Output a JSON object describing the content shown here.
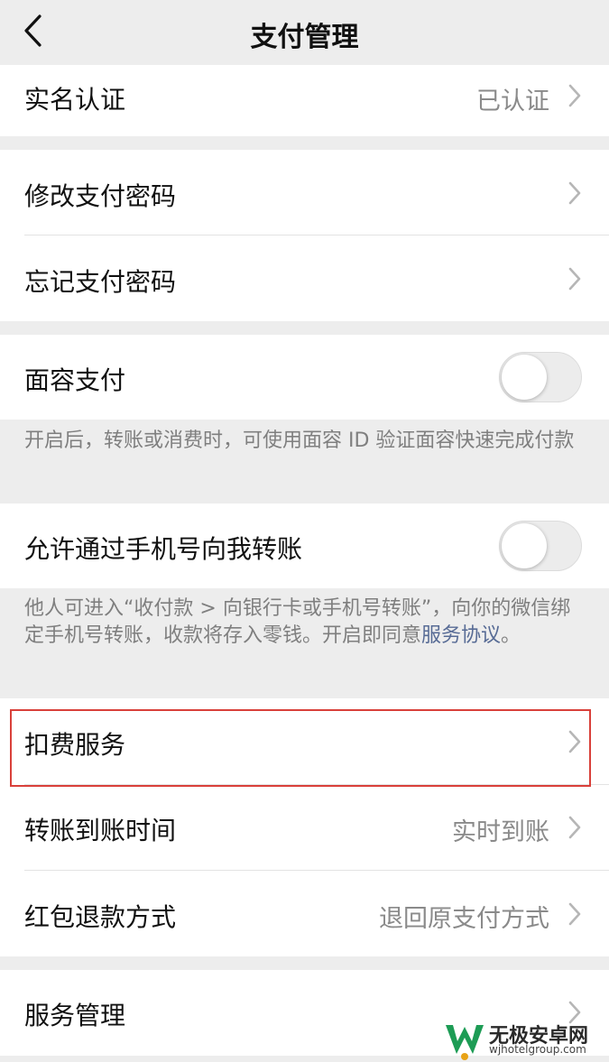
{
  "nav": {
    "title": "支付管理"
  },
  "rows": {
    "realname": {
      "label": "实名认证",
      "value": "已认证"
    },
    "change_password": {
      "label": "修改支付密码"
    },
    "forgot_password": {
      "label": "忘记支付密码"
    },
    "face_pay": {
      "label": "面容支付",
      "enabled": false,
      "note": "开启后，转账或消费时，可使用面容 ID 验证面容快速完成付款"
    },
    "phone_transfer": {
      "label": "允许通过手机号向我转账",
      "enabled": false,
      "note_text": "他人可进入“收付款 > 向银行卡或手机号转账”，向你的微信绑定手机号转账，收款将存入零钱。开启即同意",
      "note_link": "服务协议",
      "note_end": "。"
    },
    "deduction": {
      "label": "扣费服务"
    },
    "arrival_time": {
      "label": "转账到账时间",
      "value": "实时到账"
    },
    "refund": {
      "label": "红包退款方式",
      "value": "退回原支付方式"
    },
    "service_mgmt": {
      "label": "服务管理"
    }
  },
  "watermark": {
    "name": "无极安卓网",
    "url": "wjhotelgroup.com"
  },
  "colors": {
    "link": "#576b95",
    "highlight": "#d9403a",
    "background": "#ededed"
  }
}
